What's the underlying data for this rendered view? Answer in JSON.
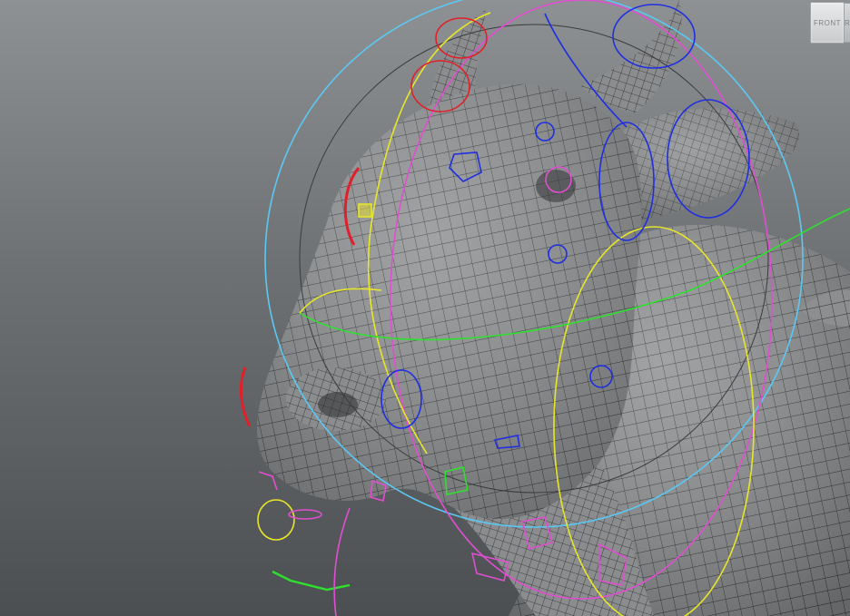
{
  "viewport": {
    "background_top": "#8e9194",
    "background_bottom": "#4c4f52"
  },
  "viewcube": {
    "front_label": "FRONT",
    "side_label": "R"
  },
  "model": {
    "icon": "cow-head-wireframe",
    "mesh_fill": "#8a8c8e",
    "wire_color": "#2b2c2e"
  },
  "rig_controls": {
    "colors": {
      "cyan": "#5bc8f2",
      "magenta": "#e04fd0",
      "yellow": "#e7e62a",
      "blue": "#1f2fe0",
      "red": "#e0202a",
      "green": "#2fe02f"
    }
  }
}
